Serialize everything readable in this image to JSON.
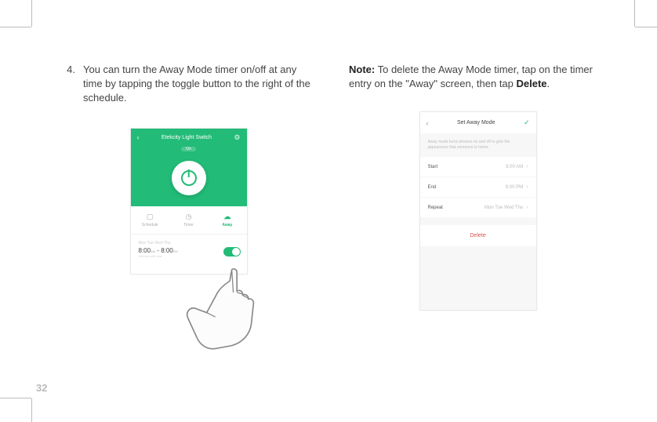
{
  "page_number": "32",
  "left": {
    "step_num": "4.",
    "step_text": "You can turn the Away Mode timer on/off at any time by tapping the toggle button to the right of the schedule."
  },
  "right": {
    "note_prefix": "Note:",
    "note_text": " To delete the Away Mode timer, tap on the timer entry on the \"Away\" screen, then tap ",
    "note_action": "Delete",
    "note_suffix": "."
  },
  "phoneA": {
    "title": "Etekcity Light Switch",
    "status": "On",
    "tabs": [
      "Schedule",
      "Timer",
      "Away"
    ],
    "entry_days": "Mon Tue Wed Thu",
    "entry_time_start": "8:00",
    "entry_time_start_ampm": "AM",
    "entry_time_sep": " - ",
    "entry_time_end": "8:00",
    "entry_time_end_ampm": "PM",
    "entry_offset": "±30 min        ±30 min"
  },
  "phoneB": {
    "title": "Set Away Mode",
    "desc": "Away mode turns devices on and off to give the appearance that someone is home.",
    "rows": [
      {
        "label": "Start",
        "value": "8:00 AM"
      },
      {
        "label": "End",
        "value": "8:00 PM"
      },
      {
        "label": "Repeat",
        "value": "Mon Tue Wed Thu"
      }
    ],
    "delete": "Delete"
  }
}
